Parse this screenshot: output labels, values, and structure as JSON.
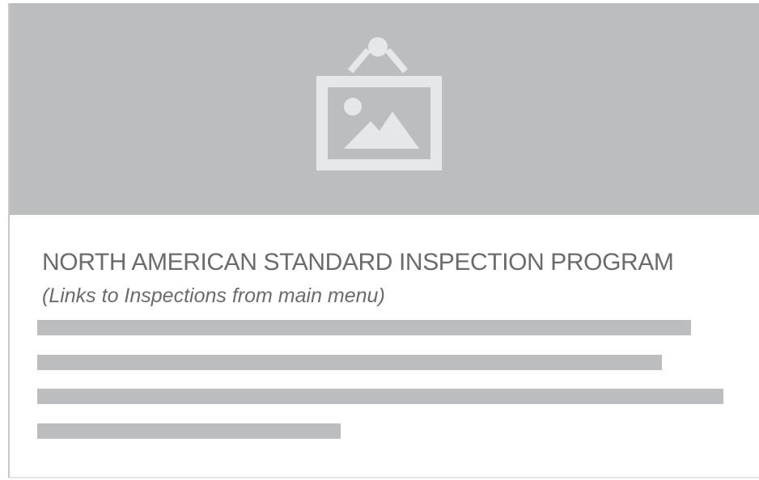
{
  "card": {
    "title": "NORTH AMERICAN STANDARD INSPECTION PROGRAM",
    "subtitle": "(Links to Inspections from main menu)",
    "hero_icon": "framed-picture-icon",
    "text_placeholder_lines": 4
  },
  "colors": {
    "placeholder_gray": "#bcbdbf",
    "icon_gray": "#e6e7e8",
    "text_gray": "#6b6b6b",
    "background": "#ffffff"
  }
}
